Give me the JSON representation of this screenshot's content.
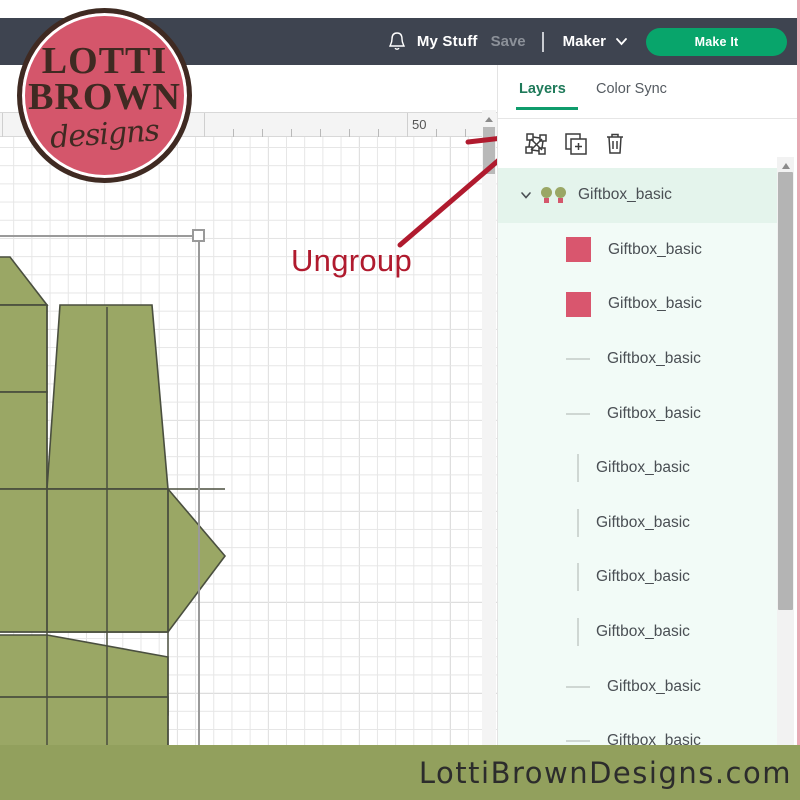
{
  "topbar": {
    "bell_icon": "bell-icon",
    "my_stuff": "My Stuff",
    "save": "Save",
    "separator": "|",
    "machine": "Maker",
    "chevron_icon": "chevron-down-icon",
    "make_it": "Make It",
    "bg_color": "#3e4450",
    "accent_green": "#08a56b"
  },
  "canvas": {
    "ruler_label": "50",
    "grid_color": "#e6e6e6",
    "shape_fill": "#9aa765",
    "shape_stroke": "#4a4f3f"
  },
  "annotation": {
    "label": "Ungroup",
    "color": "#b01a2e"
  },
  "panel": {
    "tabs": [
      {
        "label": "Layers",
        "active": true
      },
      {
        "label": "Color Sync",
        "active": false
      }
    ],
    "tools": [
      {
        "name": "ungroup-button",
        "icon": "ungroup-icon"
      },
      {
        "name": "duplicate-button",
        "icon": "duplicate-icon"
      },
      {
        "name": "delete-button",
        "icon": "trash-icon"
      }
    ],
    "active_tab_color": "#1f7a5a",
    "underline_color": "#0f9c6c",
    "group_row_bg": "#e4f4ec",
    "child_row_bg": "#f2fbf7",
    "swatch_color": "#d9566e",
    "layers": [
      {
        "name": "Giftbox_basic",
        "type": "group",
        "icon": "group-thumbnail-icon",
        "expanded": true
      },
      {
        "name": "Giftbox_basic",
        "type": "cut",
        "icon": "color-swatch-icon"
      },
      {
        "name": "Giftbox_basic",
        "type": "cut",
        "icon": "color-swatch-icon"
      },
      {
        "name": "Giftbox_basic",
        "type": "score",
        "icon": "horizontal-line-icon"
      },
      {
        "name": "Giftbox_basic",
        "type": "score",
        "icon": "horizontal-line-icon"
      },
      {
        "name": "Giftbox_basic",
        "type": "line",
        "icon": "vertical-line-icon"
      },
      {
        "name": "Giftbox_basic",
        "type": "line",
        "icon": "vertical-line-icon"
      },
      {
        "name": "Giftbox_basic",
        "type": "line",
        "icon": "vertical-line-icon"
      },
      {
        "name": "Giftbox_basic",
        "type": "line",
        "icon": "vertical-line-icon"
      },
      {
        "name": "Giftbox_basic",
        "type": "score",
        "icon": "horizontal-line-icon"
      },
      {
        "name": "Giftbox_basic",
        "type": "score",
        "icon": "horizontal-line-icon"
      }
    ]
  },
  "logo": {
    "line1": "LOTTI",
    "line2": "BROWN",
    "line3": "designs",
    "circle_color": "#d4566b",
    "ink_color": "#3f2a22"
  },
  "footer": {
    "text": "LottiBrownDesigns.com",
    "bg_color": "#92a05d"
  }
}
